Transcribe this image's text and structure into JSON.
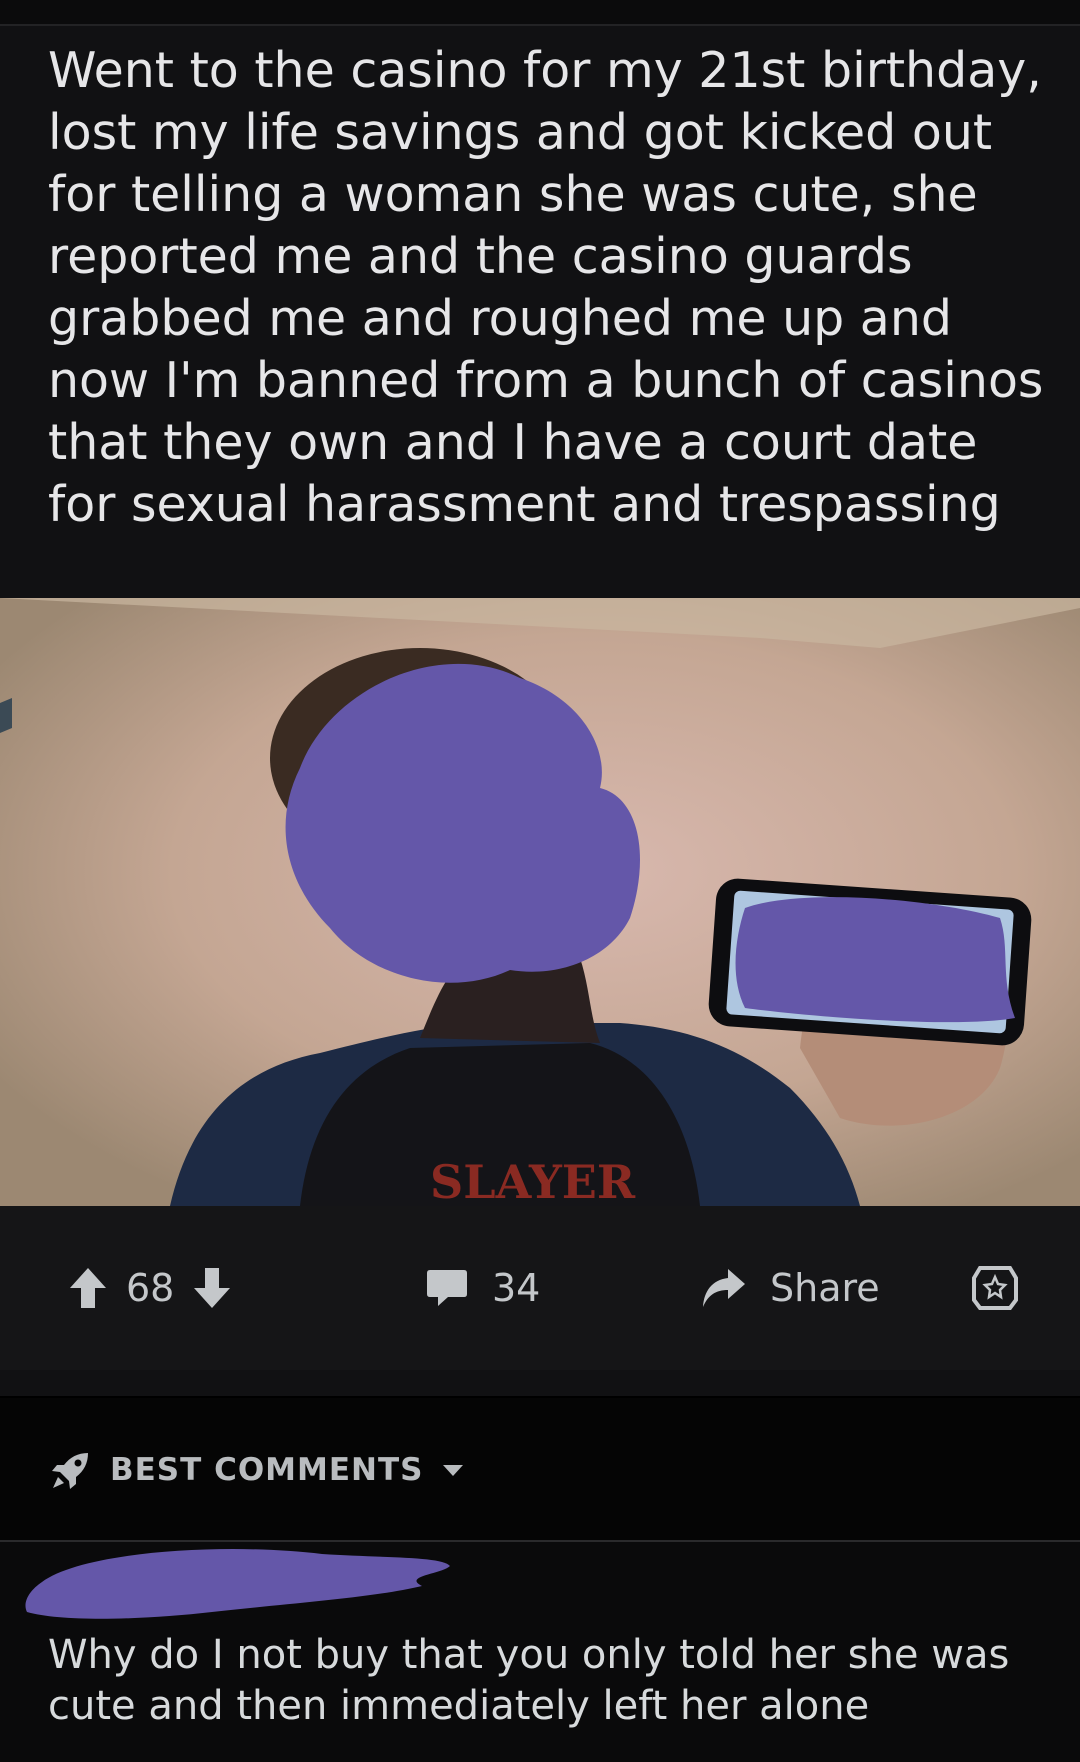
{
  "post": {
    "title": "Went to the casino for my 21st birthday, lost my life savings and got kicked out for telling a woman she was cute, she reported me and the casino guards grabbed me and roughed me up and now I'm banned from a bunch of casinos that they own and I have a court date for sexual harassment and trespassing",
    "image_shirt_text": "SLAYER"
  },
  "actions": {
    "score": "68",
    "comments_count": "34",
    "share_label": "Share"
  },
  "comments_section": {
    "sort_label": "BEST COMMENTS"
  },
  "comment": {
    "body": "Why do I not buy that you only told her she was cute and then immediately left her alone"
  },
  "colors": {
    "background": "#000000",
    "post_background": "#111113",
    "redaction_purple": "#6457a9",
    "text_primary": "#e6e6e8",
    "text_secondary": "#c4c7ca"
  },
  "icons": {
    "upvote": "arrow-up-icon",
    "downvote": "arrow-down-icon",
    "comments": "speech-bubble-icon",
    "share": "share-arrow-icon",
    "award": "award-icon",
    "sort": "rocket-icon",
    "dropdown": "caret-down-icon"
  }
}
